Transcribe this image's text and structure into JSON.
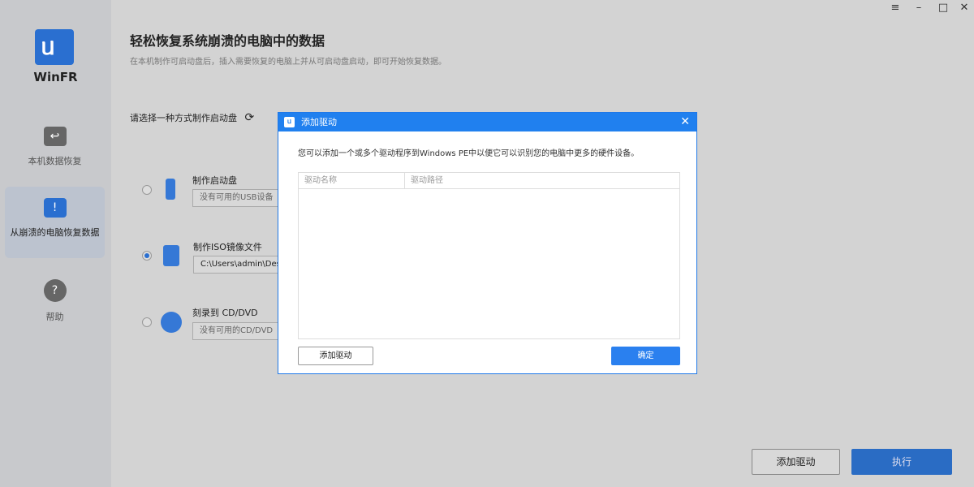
{
  "app": {
    "name": "WinFR"
  },
  "sidebar": {
    "items": [
      {
        "label": "本机数据恢复"
      },
      {
        "label": "从崩溃的电脑恢复数据"
      },
      {
        "label": "帮助"
      }
    ]
  },
  "main": {
    "title": "轻松恢复系统崩溃的电脑中的数据",
    "subtitle": "在本机制作可启动盘后，插入需要恢复的电脑上并从可启动盘启动，即可开始恢复数据。",
    "choose_label": "请选择一种方式制作启动盘",
    "options": [
      {
        "label": "制作启动盘",
        "value": "没有可用的USB设备",
        "selected": false
      },
      {
        "label": "制作ISO镜像文件",
        "value": "C:\\Users\\admin\\Desktop",
        "selected": true
      },
      {
        "label": "刻录到 CD/DVD",
        "value": "没有可用的CD/DVD",
        "selected": false
      }
    ],
    "add_driver": "添加驱动",
    "execute": "执行"
  },
  "dialog": {
    "title": "添加驱动",
    "description": "您可以添加一个或多个驱动程序到Windows PE中以便它可以识别您的电脑中更多的硬件设备。",
    "columns": [
      "驱动名称",
      "驱动路径"
    ],
    "add_button": "添加驱动",
    "ok_button": "确定"
  },
  "colors": {
    "accent": "#2080ef"
  }
}
